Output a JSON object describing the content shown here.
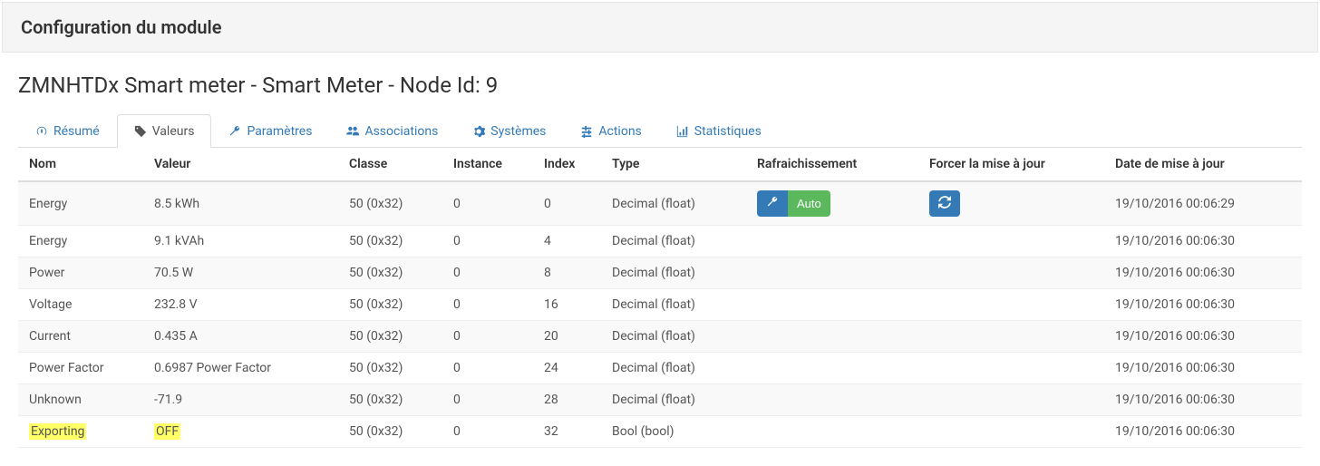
{
  "header": {
    "title": "Configuration du module"
  },
  "page_title": "ZMNHTDx Smart meter - Smart Meter - Node Id: 9",
  "tabs": [
    {
      "key": "resume",
      "label": "Résumé",
      "active": false
    },
    {
      "key": "valeurs",
      "label": "Valeurs",
      "active": true
    },
    {
      "key": "parametres",
      "label": "Paramètres",
      "active": false
    },
    {
      "key": "associations",
      "label": "Associations",
      "active": false
    },
    {
      "key": "systemes",
      "label": "Systèmes",
      "active": false
    },
    {
      "key": "actions",
      "label": "Actions",
      "active": false
    },
    {
      "key": "statistiques",
      "label": "Statistiques",
      "active": false
    }
  ],
  "columns": {
    "nom": "Nom",
    "valeur": "Valeur",
    "classe": "Classe",
    "instance": "Instance",
    "index": "Index",
    "type": "Type",
    "rafraichissement": "Rafraichissement",
    "forcer": "Forcer la mise à jour",
    "date": "Date de mise à jour"
  },
  "refresh_auto_label": "Auto",
  "rows": [
    {
      "nom": "Energy",
      "valeur": "8.5 kWh",
      "classe": "50 (0x32)",
      "instance": "0",
      "index": "0",
      "type": "Decimal (float)",
      "date": "19/10/2016 00:06:29",
      "show_refresh": true
    },
    {
      "nom": "Energy",
      "valeur": "9.1 kVAh",
      "classe": "50 (0x32)",
      "instance": "0",
      "index": "4",
      "type": "Decimal (float)",
      "date": "19/10/2016 00:06:30",
      "show_refresh": false
    },
    {
      "nom": "Power",
      "valeur": "70.5 W",
      "classe": "50 (0x32)",
      "instance": "0",
      "index": "8",
      "type": "Decimal (float)",
      "date": "19/10/2016 00:06:30",
      "show_refresh": false
    },
    {
      "nom": "Voltage",
      "valeur": "232.8 V",
      "classe": "50 (0x32)",
      "instance": "0",
      "index": "16",
      "type": "Decimal (float)",
      "date": "19/10/2016 00:06:30",
      "show_refresh": false
    },
    {
      "nom": "Current",
      "valeur": "0.435 A",
      "classe": "50 (0x32)",
      "instance": "0",
      "index": "20",
      "type": "Decimal (float)",
      "date": "19/10/2016 00:06:30",
      "show_refresh": false
    },
    {
      "nom": "Power Factor",
      "valeur": "0.6987 Power Factor",
      "classe": "50 (0x32)",
      "instance": "0",
      "index": "24",
      "type": "Decimal (float)",
      "date": "19/10/2016 00:06:30",
      "show_refresh": false
    },
    {
      "nom": "Unknown",
      "valeur": "-71.9",
      "classe": "50 (0x32)",
      "instance": "0",
      "index": "28",
      "type": "Decimal (float)",
      "date": "19/10/2016 00:06:30",
      "show_refresh": false
    },
    {
      "nom": "Exporting",
      "valeur": "OFF",
      "classe": "50 (0x32)",
      "instance": "0",
      "index": "32",
      "type": "Bool (bool)",
      "date": "19/10/2016 00:06:30",
      "show_refresh": false,
      "highlight": true
    }
  ]
}
